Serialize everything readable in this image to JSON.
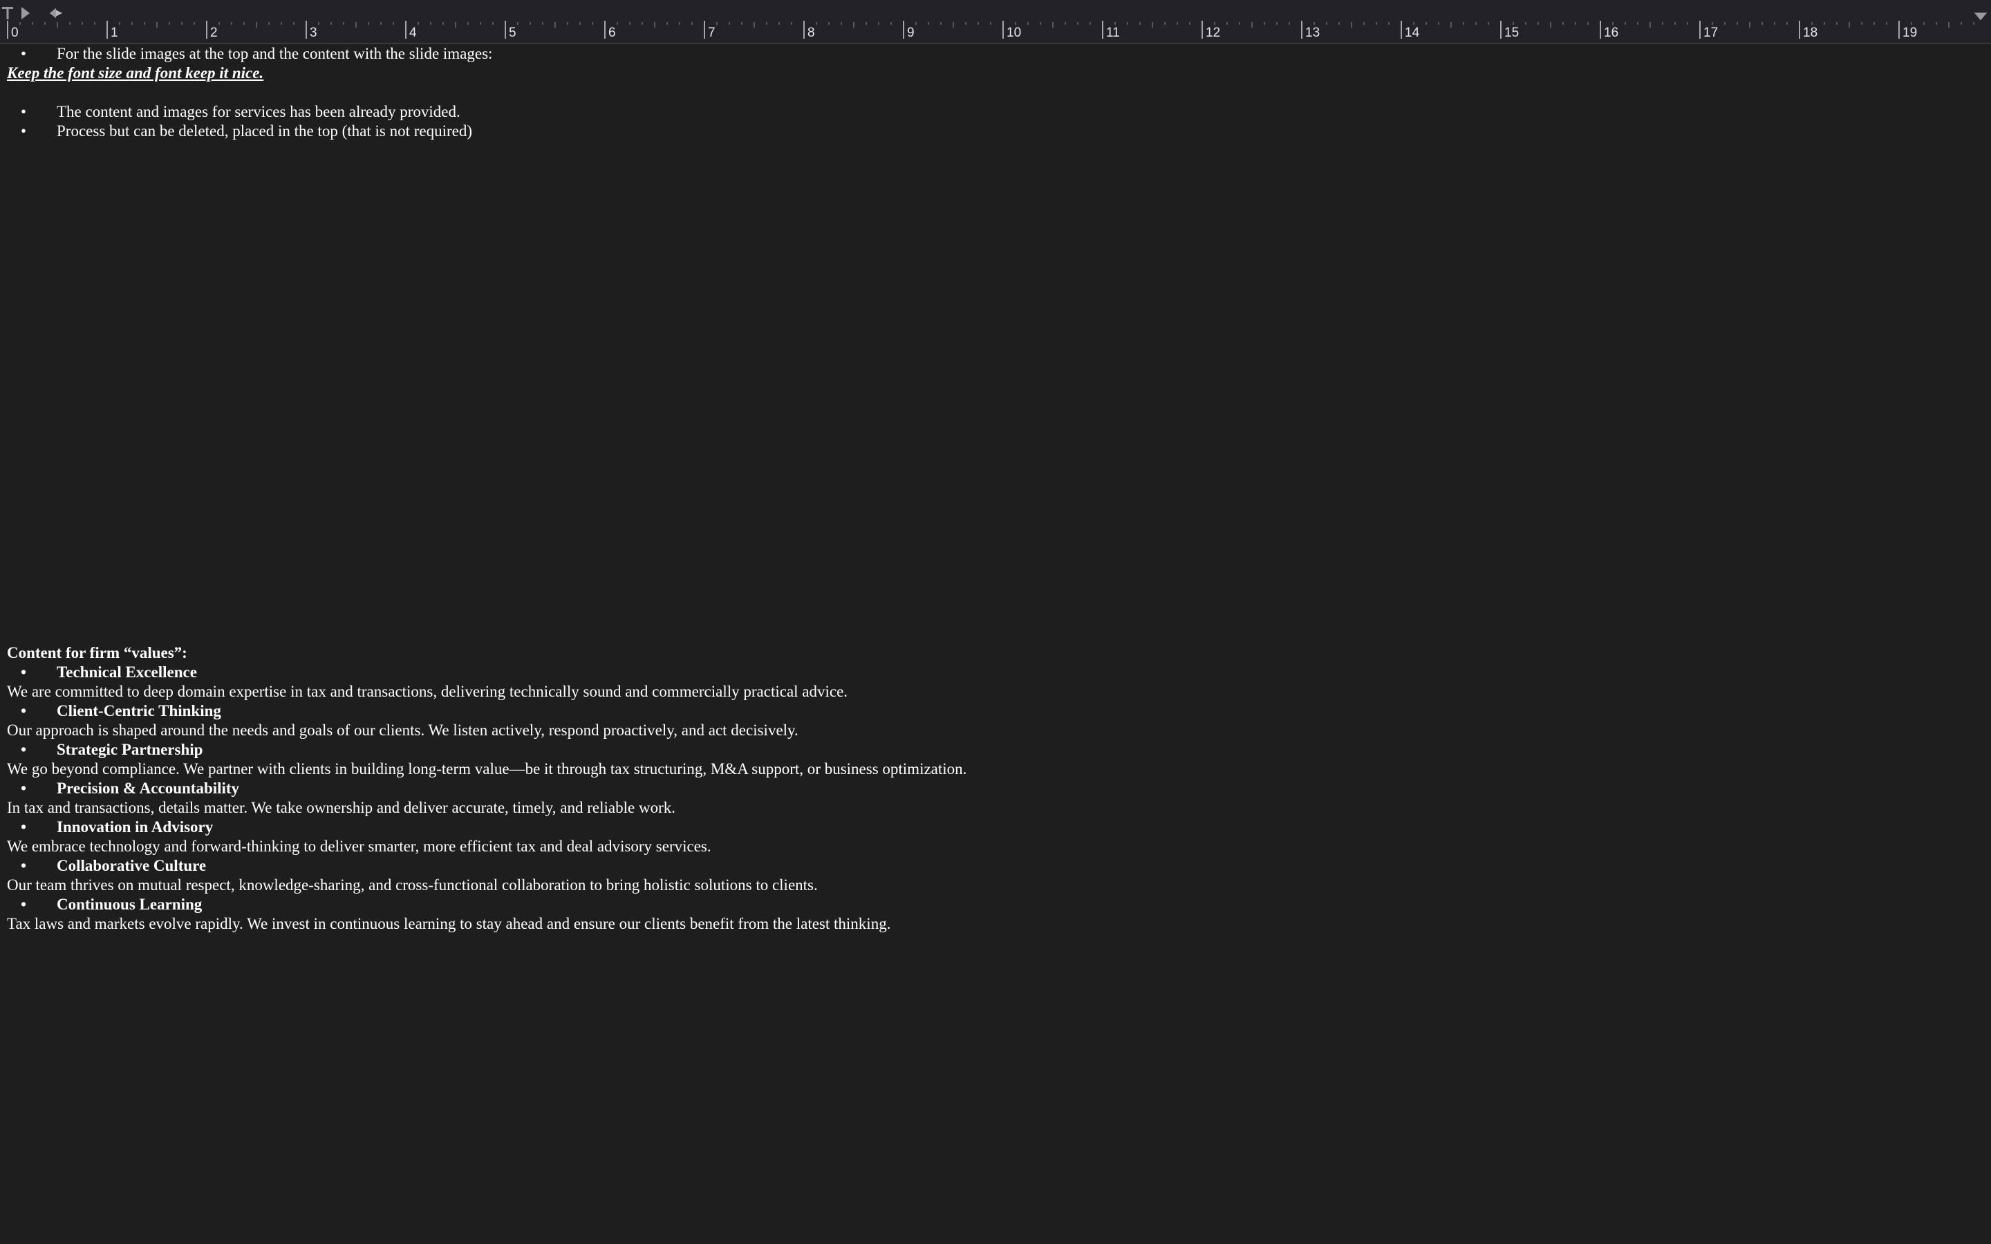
{
  "ruler": {
    "numbers": [
      "0",
      "1",
      "2",
      "3",
      "4",
      "5",
      "6",
      "7",
      "8",
      "9",
      "10",
      "11",
      "12",
      "13",
      "14",
      "15",
      "16",
      "17",
      "18",
      "19"
    ],
    "icons": {
      "left_tab": "left-tab-icon",
      "first_line_indent": "first-line-indent-icon",
      "hanging_indent": "hanging-indent-icon",
      "right_indent": "right-indent-icon"
    },
    "colors": {
      "background": "#232228",
      "tick": "#8a8990",
      "marker": "#9a9aa0"
    }
  },
  "document": {
    "background": "#1e1e1e",
    "text_color": "#ffffff",
    "instructions": {
      "bullet_1": "For the slide images at the top and the content with the slide images:",
      "note": "Keep the font size and font keep it nice.",
      "bullet_2": "The content and images for services has been already provided.",
      "bullet_3": "Process but can be deleted, placed in the top (that is not required)"
    },
    "bullet_char": "•",
    "values": {
      "heading": "Content for firm “values”:",
      "items": [
        {
          "title": "Technical Excellence",
          "description": "We are committed to deep domain expertise in tax and transactions, delivering technically sound and commercially practical advice."
        },
        {
          "title": "Client-Centric Thinking",
          "description": "Our approach is shaped around the needs and goals of our clients. We listen actively, respond proactively, and act decisively."
        },
        {
          "title": "Strategic Partnership",
          "description": "We go beyond compliance. We partner with clients in building long-term value—be it through tax structuring, M&A support, or business optimization."
        },
        {
          "title": "Precision & Accountability",
          "description": "In tax and transactions, details matter. We take ownership and deliver accurate, timely, and reliable work."
        },
        {
          "title": "Innovation in Advisory",
          "description": "We embrace technology and forward-thinking to deliver smarter, more efficient tax and deal advisory services."
        },
        {
          "title": "Collaborative Culture",
          "description": "Our team thrives on mutual respect, knowledge-sharing, and cross-functional collaboration to bring holistic solutions to clients."
        },
        {
          "title": "Continuous Learning",
          "description": "Tax laws and markets evolve rapidly. We invest in continuous learning to stay ahead and ensure our clients benefit from the latest thinking."
        }
      ]
    }
  }
}
